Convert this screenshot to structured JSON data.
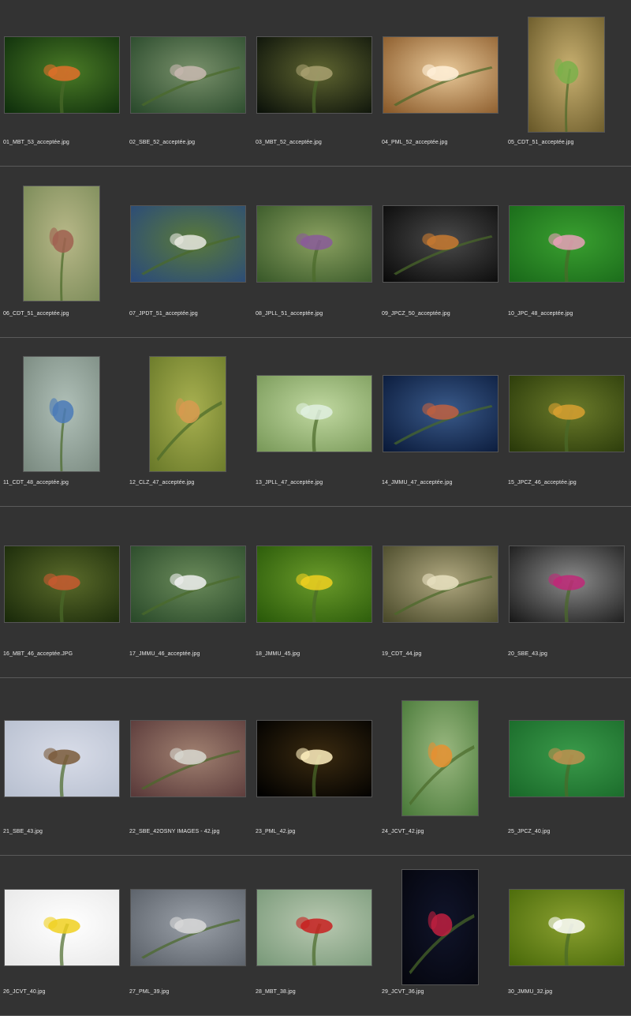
{
  "rows": [
    {
      "h": 211,
      "items": [
        {
          "file": "01_MBT_53_acceptée.jpg",
          "orient": "l",
          "thumb": "butterflies-pair",
          "c1": "#0f2f0c",
          "c2": "#4a7a26",
          "acc": "#e0702a"
        },
        {
          "file": "02_SBE_52_acceptée.jpg",
          "orient": "l",
          "thumb": "mantis-on-stem",
          "c1": "#2a4a2c",
          "c2": "#78906a",
          "acc": "#c8b8b0"
        },
        {
          "file": "03_MBT_52_acceptée.jpg",
          "orient": "l",
          "thumb": "spider-web-grass",
          "c1": "#0c120a",
          "c2": "#5e6430",
          "acc": "#a8a070"
        },
        {
          "file": "04_PML_52_acceptée.jpg",
          "orient": "l",
          "thumb": "water-bokeh-insect",
          "c1": "#8a5a2a",
          "c2": "#e8c898",
          "acc": "#fff0d8"
        },
        {
          "file": "05_CDT_51_acceptée.jpg",
          "orient": "p",
          "thumb": "mantis-on-plant",
          "c1": "#6a5a2a",
          "c2": "#c8b070",
          "acc": "#7ab04a"
        }
      ]
    },
    {
      "h": 217,
      "items": [
        {
          "file": "06_CDT_51_acceptée.jpg",
          "orient": "p",
          "thumb": "mantis-pair-stem",
          "c1": "#7a8a58",
          "c2": "#b8b888",
          "acc": "#a06050"
        },
        {
          "file": "07_JPDT_51_acceptée.jpg",
          "orient": "l",
          "thumb": "beetles-on-flower",
          "c1": "#2a4a7a",
          "c2": "#5a7a3a",
          "acc": "#e8e8e0"
        },
        {
          "file": "08_JPLL_51_acceptée.jpg",
          "orient": "l",
          "thumb": "fly-on-dewy-stem",
          "c1": "#3a5a2a",
          "c2": "#8aa060",
          "acc": "#8a5a9a"
        },
        {
          "file": "09_JPCZ_50_acceptée.jpg",
          "orient": "l",
          "thumb": "tarantula-on-rock",
          "c1": "#0a0a0a",
          "c2": "#4a4a4a",
          "acc": "#c87a30"
        },
        {
          "file": "10_JPC_48_acceptée.jpg",
          "orient": "l",
          "thumb": "wasp-on-pink-flower",
          "c1": "#1a6a1a",
          "c2": "#3aa030",
          "acc": "#e8a0b8"
        }
      ]
    },
    {
      "h": 214,
      "items": [
        {
          "file": "11_CDT_48_acceptée.jpg",
          "orient": "p",
          "thumb": "blue-butterfly-wings",
          "c1": "#7a8a80",
          "c2": "#b0c0b8",
          "acc": "#4a7ab8"
        },
        {
          "file": "12_CLZ_47_acceptée.jpg",
          "orient": "p",
          "thumb": "moth-on-flower-spike",
          "c1": "#6a7a2a",
          "c2": "#a8b050",
          "acc": "#d89a50"
        },
        {
          "file": "13_JPLL_47_acceptée.jpg",
          "orient": "l",
          "thumb": "fly-on-dewy-leaf",
          "c1": "#7a9a5a",
          "c2": "#c0d8a0",
          "acc": "#e0f0e0"
        },
        {
          "file": "14_JMMU_47_acceptée.jpg",
          "orient": "l",
          "thumb": "damselflies-over-water",
          "c1": "#0a1a3a",
          "c2": "#3a5a8a",
          "acc": "#c06040"
        },
        {
          "file": "15_JPCZ_46_acceptée.jpg",
          "orient": "l",
          "thumb": "hoverflies-on-leaf",
          "c1": "#2a3a0a",
          "c2": "#6a7a2a",
          "acc": "#d8a030"
        }
      ]
    },
    {
      "h": 217,
      "items": [
        {
          "file": "16_MBT_46_acceptée.JPG",
          "orient": "l",
          "thumb": "dragonfly-on-branch",
          "c1": "#1a2a0a",
          "c2": "#5a6a2a",
          "acc": "#c85a30"
        },
        {
          "file": "17_JMMU_46_acceptée.jpg",
          "orient": "l",
          "thumb": "insect-on-white-flowers",
          "c1": "#2a4a2a",
          "c2": "#6a8a5a",
          "acc": "#f0f0f0"
        },
        {
          "file": "18_JMMU_45.jpg",
          "orient": "l",
          "thumb": "insect-on-grass",
          "c1": "#2a5a0a",
          "c2": "#6a9a2a",
          "acc": "#f0d020"
        },
        {
          "file": "19_CDT_44.jpg",
          "orient": "l",
          "thumb": "mushrooms",
          "c1": "#4a4a2a",
          "c2": "#b0a880",
          "acc": "#e8e0c0"
        },
        {
          "file": "20_SBE_43.jpg",
          "orient": "l",
          "thumb": "pink-flowers",
          "c1": "#1a1a1a",
          "c2": "#8a8a8a",
          "acc": "#c02878"
        }
      ]
    },
    {
      "h": 225,
      "items": [
        {
          "file": "21_SBE_43.jpg",
          "orient": "l",
          "thumb": "seed-heads-string",
          "c1": "#b8c0d0",
          "c2": "#d8dce8",
          "acc": "#7a5a3a"
        },
        {
          "file": "22_SBE_42OSNY IMAGES - 42.jpg",
          "orient": "l",
          "thumb": "white-mushrooms",
          "c1": "#5a3a3a",
          "c2": "#a08070",
          "acc": "#d8d8d0"
        },
        {
          "file": "23_PML_42.jpg",
          "orient": "l",
          "thumb": "dragonfly-silhouette-sun",
          "c1": "#000000",
          "c2": "#3a2a10",
          "acc": "#fff0c0"
        },
        {
          "file": "24_JCVT_42.jpg",
          "orient": "p",
          "thumb": "caterpillar-on-thistle",
          "c1": "#4a7a3a",
          "c2": "#9ab880",
          "acc": "#e89030"
        },
        {
          "file": "25_JPCZ_40.jpg",
          "orient": "l",
          "thumb": "fly-on-green-leaf",
          "c1": "#1a6a2a",
          "c2": "#3a9a4a",
          "acc": "#c09050"
        }
      ]
    },
    {
      "h": 203,
      "items": [
        {
          "file": "26_JCVT_40.jpg",
          "orient": "l",
          "thumb": "crab-spider-on-daisy",
          "c1": "#e8e8e8",
          "c2": "#ffffff",
          "acc": "#f0d020"
        },
        {
          "file": "27_PML_39.jpg",
          "orient": "l",
          "thumb": "reflection-on-water",
          "c1": "#5a6068",
          "c2": "#9aa0a8",
          "acc": "#d8d8d8"
        },
        {
          "file": "28_MBT_38.jpg",
          "orient": "l",
          "thumb": "ladybug-on-grass",
          "c1": "#7a9a7a",
          "c2": "#b8c8b0",
          "acc": "#c82020"
        },
        {
          "file": "29_JCVT_36.jpg",
          "orient": "p",
          "thumb": "red-stems-dark",
          "c1": "#05060e",
          "c2": "#10142a",
          "acc": "#c02040"
        },
        {
          "file": "30_JMMU_32.jpg",
          "orient": "l",
          "thumb": "beetle-on-white-flower",
          "c1": "#4a6a0a",
          "c2": "#8aa030",
          "acc": "#ffffff"
        }
      ]
    }
  ]
}
